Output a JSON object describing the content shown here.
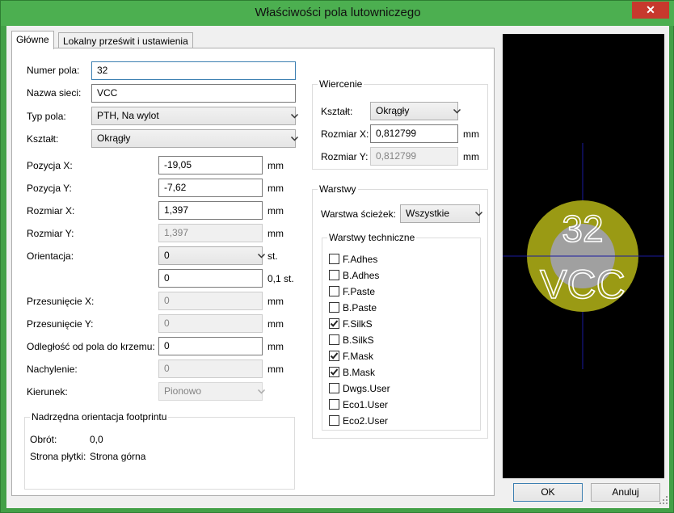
{
  "window": {
    "title": "Właściwości pola lutowniczego",
    "close_glyph": "✕"
  },
  "tabs": [
    {
      "label": "Główne",
      "active": true
    },
    {
      "label": "Lokalny prześwit i ustawienia",
      "active": false
    }
  ],
  "general": {
    "pad_number": {
      "label": "Numer pola:",
      "value": "32"
    },
    "net_name": {
      "label": "Nazwa sieci:",
      "value": "VCC"
    },
    "pad_type": {
      "label": "Typ pola:",
      "value": "PTH, Na wylot"
    },
    "shape": {
      "label": "Kształt:",
      "value": "Okrągły"
    },
    "pos_x": {
      "label": "Pozycja X:",
      "value": "-19,05",
      "unit": "mm"
    },
    "pos_y": {
      "label": "Pozycja Y:",
      "value": "-7,62",
      "unit": "mm"
    },
    "size_x": {
      "label": "Rozmiar X:",
      "value": "1,397",
      "unit": "mm"
    },
    "size_y": {
      "label": "Rozmiar Y:",
      "value": "1,397",
      "unit": "mm"
    },
    "orientation": {
      "label": "Orientacja:",
      "value": "0",
      "unit": "st.",
      "custom_value": "0",
      "custom_unit": "0,1 st."
    },
    "offset_x": {
      "label": "Przesunięcie X:",
      "value": "0",
      "unit": "mm"
    },
    "offset_y": {
      "label": "Przesunięcie Y:",
      "value": "0",
      "unit": "mm"
    },
    "pad_to_die": {
      "label": "Odległość od pola do krzemu:",
      "value": "0",
      "unit": "mm"
    },
    "trapezoid": {
      "label": "Nachylenie:",
      "value": "0",
      "unit": "mm"
    },
    "direction": {
      "label": "Kierunek:",
      "value": "Pionowo"
    }
  },
  "parent": {
    "title": "Nadrzędna orientacja footprintu",
    "rotation": {
      "label": "Obrót:",
      "value": "0,0"
    },
    "board_side": {
      "label": "Strona płytki:",
      "value": "Strona górna"
    }
  },
  "drill": {
    "title": "Wiercenie",
    "shape": {
      "label": "Kształt:",
      "value": "Okrągły"
    },
    "size_x": {
      "label": "Rozmiar X:",
      "value": "0,812799",
      "unit": "mm"
    },
    "size_y": {
      "label": "Rozmiar Y:",
      "value": "0,812799",
      "unit": "mm"
    }
  },
  "layers": {
    "title": "Warstwy",
    "copper": {
      "label": "Warstwa ścieżek:",
      "value": "Wszystkie"
    },
    "technical_title": "Warstwy techniczne",
    "items": [
      {
        "label": "F.Adhes",
        "checked": false
      },
      {
        "label": "B.Adhes",
        "checked": false
      },
      {
        "label": "F.Paste",
        "checked": false
      },
      {
        "label": "B.Paste",
        "checked": false
      },
      {
        "label": "F.SilkS",
        "checked": true
      },
      {
        "label": "B.SilkS",
        "checked": false
      },
      {
        "label": "F.Mask",
        "checked": true
      },
      {
        "label": "B.Mask",
        "checked": true
      },
      {
        "label": "Dwgs.User",
        "checked": false
      },
      {
        "label": "Eco1.User",
        "checked": false
      },
      {
        "label": "Eco2.User",
        "checked": false
      }
    ]
  },
  "preview": {
    "pad_number": "32",
    "net_name": "VCC",
    "pad_color": "#9a9a14",
    "hole_color": "#a0a0a0",
    "crosshair_color": "#1a1aa0"
  },
  "buttons": {
    "ok": "OK",
    "cancel": "Anuluj"
  }
}
